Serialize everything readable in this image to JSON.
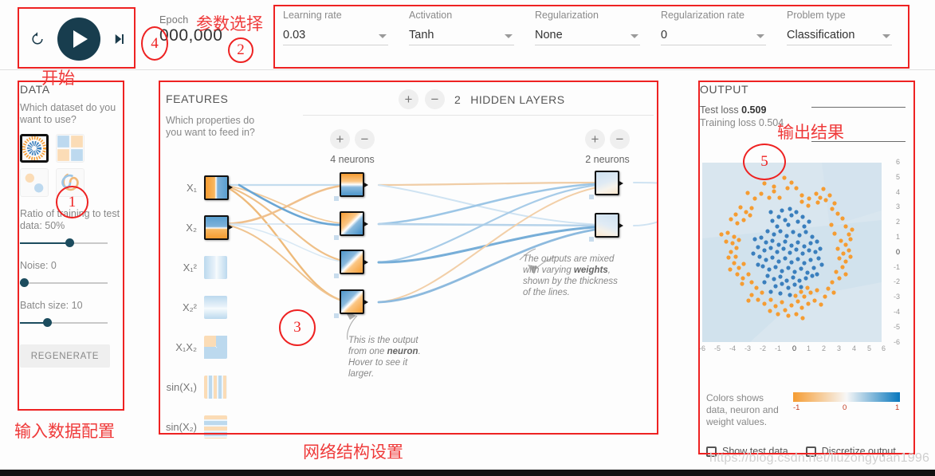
{
  "topbar": {
    "reset_icon": "replay-icon",
    "play_icon": "play-icon",
    "step_icon": "step-forward-icon",
    "epoch_label": "Epoch",
    "epoch_value": "000,000",
    "controls": [
      {
        "label": "Learning rate",
        "value": "0.03"
      },
      {
        "label": "Activation",
        "value": "Tanh"
      },
      {
        "label": "Regularization",
        "value": "None"
      },
      {
        "label": "Regularization rate",
        "value": "0"
      },
      {
        "label": "Problem type",
        "value": "Classification"
      }
    ]
  },
  "data_panel": {
    "title": "DATA",
    "question": "Which dataset do you want to use?",
    "datasets": [
      {
        "name": "circle-dataset",
        "selected": true
      },
      {
        "name": "exclusive-or-dataset",
        "selected": false
      },
      {
        "name": "gaussian-dataset",
        "selected": false
      },
      {
        "name": "spiral-dataset",
        "selected": false
      }
    ],
    "ratio_label": "Ratio of training to test data:  50%",
    "ratio_value": 50,
    "noise_label": "Noise:  0",
    "noise_value": 0,
    "batch_label": "Batch size:  10",
    "batch_value": 10,
    "regenerate_label": "REGENERATE"
  },
  "network": {
    "features_title": "FEATURES",
    "features_question": "Which properties do you want to feed in?",
    "hidden_layers_count": "2",
    "hidden_layers_label": "HIDDEN LAYERS",
    "plus_icon": "plus-icon",
    "minus_icon": "minus-icon",
    "layer1_neurons": "4 neurons",
    "layer2_neurons": "2 neurons",
    "features": [
      {
        "label": "X₁",
        "active": true
      },
      {
        "label": "X₂",
        "active": true
      },
      {
        "label": "X₁²",
        "active": false
      },
      {
        "label": "X₂²",
        "active": false
      },
      {
        "label": "X₁X₂",
        "active": false
      },
      {
        "label": "sin(X₁)",
        "active": false
      },
      {
        "label": "sin(X₂)",
        "active": false
      }
    ],
    "note_neuron": "This is the output from one neuron. Hover to see it larger.",
    "note_neuron_bold": "neuron",
    "note_weights": "The outputs are mixed with varying weights, shown by the thickness of the lines.",
    "note_weights_bold": "weights"
  },
  "output": {
    "title": "OUTPUT",
    "test_loss_label": "Test loss",
    "test_loss_value": "0.509",
    "training_loss_label": "Training loss",
    "training_loss_value": "0.504",
    "legend_text": "Colors shows data, neuron and weight values.",
    "gradient_ticks": [
      "-1",
      "0",
      "1"
    ],
    "show_test_data_label": "Show test data",
    "discretize_output_label": "Discretize output",
    "show_test_data_checked": false,
    "discretize_output_checked": false,
    "axis_ticks": [
      "-6",
      "-5",
      "-4",
      "-3",
      "-2",
      "-1",
      "0",
      "1",
      "2",
      "3",
      "4",
      "5",
      "6"
    ]
  },
  "annotations": {
    "start_label": "开始",
    "param_select_label": "参数选择",
    "input_data_config_label": "输入数据配置",
    "network_structure_label": "网络结构设置",
    "output_result_label": "输出结果",
    "markers": [
      "1",
      "2",
      "3",
      "4",
      "5"
    ]
  },
  "watermark": "https://blog.csdn.net/liuzongyuan1996",
  "colors": {
    "negative": "#f59c32",
    "positive": "#0877bd",
    "accent_dark": "#183d4e",
    "annotation_red": "#ee2222"
  },
  "chart_data": {
    "type": "scatter",
    "title": "OUTPUT",
    "xlabel": "",
    "ylabel": "",
    "xlim": [
      -6,
      6
    ],
    "ylim": [
      -6,
      6
    ],
    "grid": false,
    "legend": "Colors shows data, neuron and weight values.",
    "series": [
      {
        "name": "class-negative",
        "color": "#f59c32",
        "count": 125,
        "description": "outer ring cluster"
      },
      {
        "name": "class-positive",
        "color": "#3a7fbd",
        "count": 125,
        "description": "inner core cluster"
      }
    ]
  }
}
